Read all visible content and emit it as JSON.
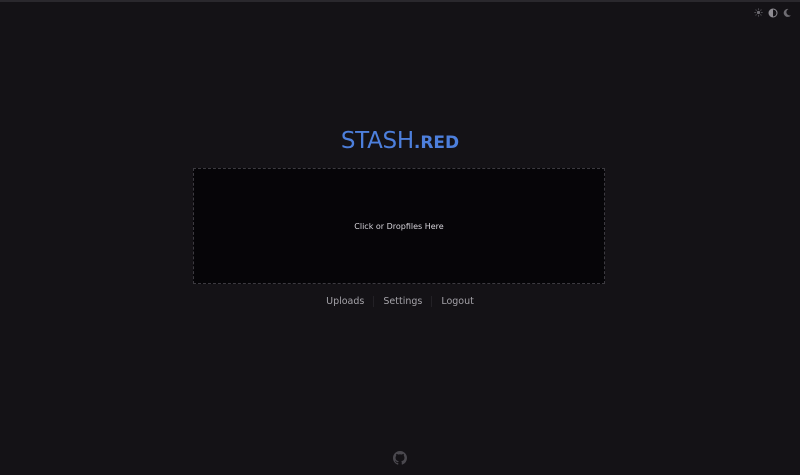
{
  "theme_switcher": {
    "options": [
      {
        "icon": "sun-icon"
      },
      {
        "icon": "contrast-icon"
      },
      {
        "icon": "moon-icon"
      }
    ]
  },
  "logo": {
    "main": "STASH",
    "tld": ".RED"
  },
  "dropzone": {
    "label": "Click or Dropfiles Here"
  },
  "nav": {
    "uploads": "Uploads",
    "settings": "Settings",
    "logout": "Logout"
  },
  "footer": {
    "icon": "github-icon"
  },
  "colors": {
    "background": "#141216",
    "accent": "#4d7fdc",
    "dropzone_bg": "#060508",
    "nav_text": "#a4a2a8"
  }
}
